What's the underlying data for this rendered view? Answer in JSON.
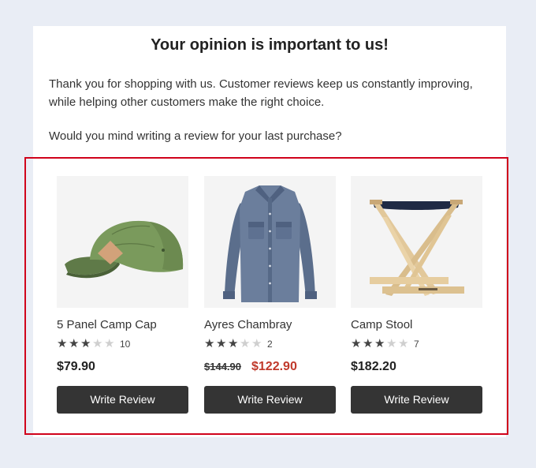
{
  "email": {
    "title": "Your opinion is important to us!",
    "intro": "Thank you for shopping with us. Customer reviews keep us constantly improving, while helping other customers make the right choice.",
    "question": "Would you mind writing a review for your last purchase?"
  },
  "colors": {
    "background": "#e9edf5",
    "card": "#ffffff",
    "highlight_border": "#d0021b",
    "button": "#343434",
    "sale_price": "#c0392b"
  },
  "products": [
    {
      "name": "5 Panel Camp Cap",
      "image": "green-cap-image",
      "rating": 3,
      "rating_max": 5,
      "review_count": "10",
      "price": "$79.90",
      "button_label": "Write Review"
    },
    {
      "name": "Ayres Chambray",
      "image": "chambray-shirt-image",
      "rating": 3,
      "rating_max": 5,
      "review_count": "2",
      "price_original": "$144.90",
      "price_sale": "$122.90",
      "button_label": "Write Review"
    },
    {
      "name": "Camp Stool",
      "image": "camp-stool-image",
      "rating": 3,
      "rating_max": 5,
      "review_count": "7",
      "price": "$182.20",
      "button_label": "Write Review"
    }
  ]
}
